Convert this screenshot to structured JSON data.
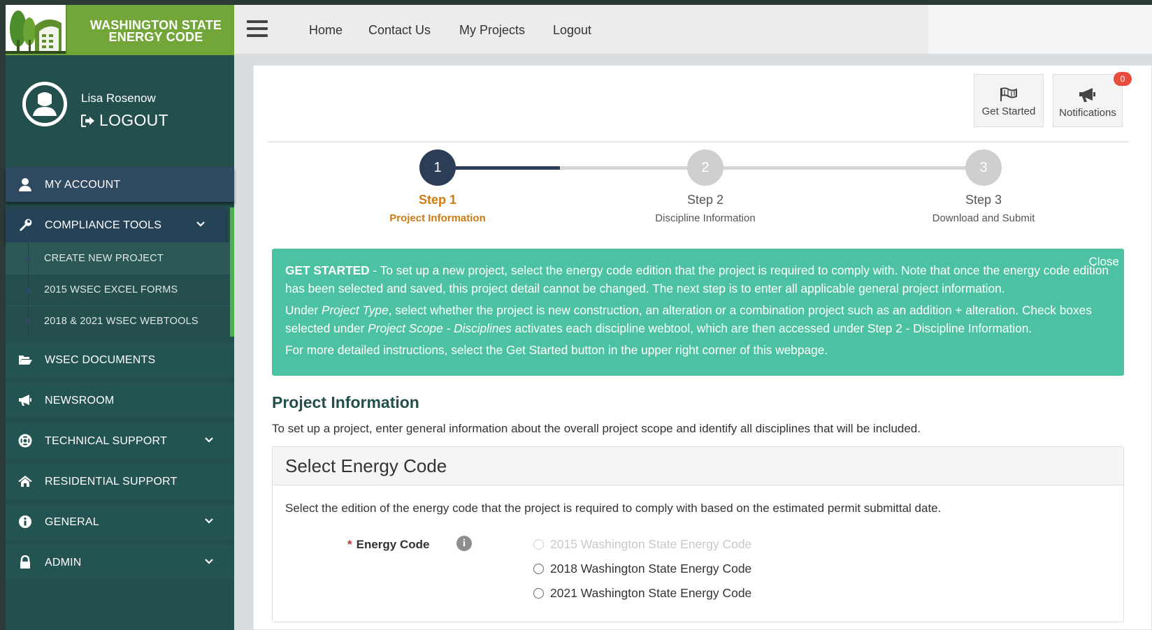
{
  "brand": {
    "line1": "WASHINGTON STATE",
    "line2": "ENERGY CODE"
  },
  "user": {
    "name": "Lisa Rosenow",
    "logout": "LOGOUT"
  },
  "sidebar": {
    "items": [
      {
        "label": "MY ACCOUNT",
        "icon": "user-icon"
      },
      {
        "label": "COMPLIANCE TOOLS",
        "icon": "wrench-icon",
        "expanded": true
      },
      {
        "label": "WSEC DOCUMENTS",
        "icon": "folder-open-icon"
      },
      {
        "label": "NEWSROOM",
        "icon": "megaphone-icon"
      },
      {
        "label": "TECHNICAL SUPPORT",
        "icon": "life-ring-icon"
      },
      {
        "label": "RESIDENTIAL SUPPORT",
        "icon": "home-icon"
      },
      {
        "label": "GENERAL",
        "icon": "info-circle-icon"
      },
      {
        "label": "ADMIN",
        "icon": "lock-icon"
      }
    ],
    "sub_items": [
      "CREATE NEW PROJECT",
      "2015 WSEC EXCEL FORMS",
      "2018 & 2021 WSEC WEBTOOLS"
    ]
  },
  "topnav": {
    "links": [
      "Home",
      "Contact Us",
      "My Projects",
      "Logout"
    ]
  },
  "toolbar": {
    "get_started": "Get Started",
    "notifications": "Notifications",
    "notification_count": "0"
  },
  "steps": [
    {
      "number": "1",
      "title": "Step 1",
      "subtitle": "Project Information",
      "active": true
    },
    {
      "number": "2",
      "title": "Step 2",
      "subtitle": "Discipline Information"
    },
    {
      "number": "3",
      "title": "Step 3",
      "subtitle": "Download and Submit"
    }
  ],
  "alert": {
    "close": "Close",
    "strong": "GET STARTED",
    "p1_rest": " - To set up a new project, select the energy code edition that the project is required to comply with. Note that once the energy code edition has been selected and saved, this project detail cannot be changed. The next step is to enter all applicable general project information.",
    "p2_a": "Under ",
    "p2_em1": "Project Type",
    "p2_b": ", select whether the project is new construction, an alteration or a combination project such as an addition + alteration. Check boxes selected under ",
    "p2_em2": "Project Scope - Disciplines",
    "p2_c": " activates each discipline webtool, which are then accessed under Step 2 - Discipline Information.",
    "p3": "For more detailed instructions, select the Get Started button in the upper right corner of this webpage."
  },
  "project_info": {
    "title": "Project Information",
    "description": "To set up a project, enter general information about the overall project scope and identify all disciplines that will be included."
  },
  "energy_code_panel": {
    "heading": "Select Energy Code",
    "description": "Select the edition of the energy code that the project is required to comply with based on the estimated permit submittal date.",
    "field_label": "Energy Code",
    "required_mark": "*",
    "info_glyph": "i",
    "options": [
      {
        "label": "2015 Washington State Energy Code",
        "disabled": true
      },
      {
        "label": "2018 Washington State Energy Code",
        "disabled": false
      },
      {
        "label": "2021 Washington State Energy Code",
        "disabled": false
      }
    ]
  },
  "colors": {
    "sidebar": "#234f4c",
    "logo_green": "#73a638",
    "step_active": "#d07a12",
    "alert": "#4cc2a3",
    "accent_bar": "#4caf50"
  }
}
